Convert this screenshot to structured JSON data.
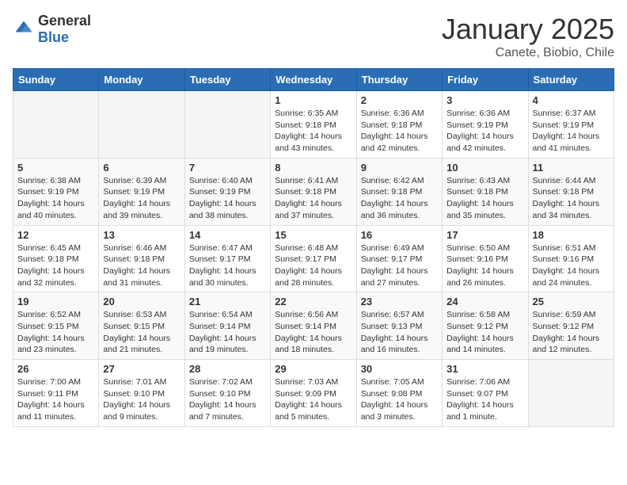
{
  "header": {
    "logo": {
      "general": "General",
      "blue": "Blue"
    },
    "title": "January 2025",
    "subtitle": "Canete, Biobio, Chile"
  },
  "weekdays": [
    "Sunday",
    "Monday",
    "Tuesday",
    "Wednesday",
    "Thursday",
    "Friday",
    "Saturday"
  ],
  "weeks": [
    [
      {
        "day": "",
        "sunrise": "",
        "sunset": "",
        "daylight": "",
        "empty": true
      },
      {
        "day": "",
        "sunrise": "",
        "sunset": "",
        "daylight": "",
        "empty": true
      },
      {
        "day": "",
        "sunrise": "",
        "sunset": "",
        "daylight": "",
        "empty": true
      },
      {
        "day": "1",
        "sunrise": "Sunrise: 6:35 AM",
        "sunset": "Sunset: 9:18 PM",
        "daylight": "Daylight: 14 hours and 43 minutes."
      },
      {
        "day": "2",
        "sunrise": "Sunrise: 6:36 AM",
        "sunset": "Sunset: 9:18 PM",
        "daylight": "Daylight: 14 hours and 42 minutes."
      },
      {
        "day": "3",
        "sunrise": "Sunrise: 6:36 AM",
        "sunset": "Sunset: 9:19 PM",
        "daylight": "Daylight: 14 hours and 42 minutes."
      },
      {
        "day": "4",
        "sunrise": "Sunrise: 6:37 AM",
        "sunset": "Sunset: 9:19 PM",
        "daylight": "Daylight: 14 hours and 41 minutes."
      }
    ],
    [
      {
        "day": "5",
        "sunrise": "Sunrise: 6:38 AM",
        "sunset": "Sunset: 9:19 PM",
        "daylight": "Daylight: 14 hours and 40 minutes."
      },
      {
        "day": "6",
        "sunrise": "Sunrise: 6:39 AM",
        "sunset": "Sunset: 9:19 PM",
        "daylight": "Daylight: 14 hours and 39 minutes."
      },
      {
        "day": "7",
        "sunrise": "Sunrise: 6:40 AM",
        "sunset": "Sunset: 9:19 PM",
        "daylight": "Daylight: 14 hours and 38 minutes."
      },
      {
        "day": "8",
        "sunrise": "Sunrise: 6:41 AM",
        "sunset": "Sunset: 9:18 PM",
        "daylight": "Daylight: 14 hours and 37 minutes."
      },
      {
        "day": "9",
        "sunrise": "Sunrise: 6:42 AM",
        "sunset": "Sunset: 9:18 PM",
        "daylight": "Daylight: 14 hours and 36 minutes."
      },
      {
        "day": "10",
        "sunrise": "Sunrise: 6:43 AM",
        "sunset": "Sunset: 9:18 PM",
        "daylight": "Daylight: 14 hours and 35 minutes."
      },
      {
        "day": "11",
        "sunrise": "Sunrise: 6:44 AM",
        "sunset": "Sunset: 9:18 PM",
        "daylight": "Daylight: 14 hours and 34 minutes."
      }
    ],
    [
      {
        "day": "12",
        "sunrise": "Sunrise: 6:45 AM",
        "sunset": "Sunset: 9:18 PM",
        "daylight": "Daylight: 14 hours and 32 minutes."
      },
      {
        "day": "13",
        "sunrise": "Sunrise: 6:46 AM",
        "sunset": "Sunset: 9:18 PM",
        "daylight": "Daylight: 14 hours and 31 minutes."
      },
      {
        "day": "14",
        "sunrise": "Sunrise: 6:47 AM",
        "sunset": "Sunset: 9:17 PM",
        "daylight": "Daylight: 14 hours and 30 minutes."
      },
      {
        "day": "15",
        "sunrise": "Sunrise: 6:48 AM",
        "sunset": "Sunset: 9:17 PM",
        "daylight": "Daylight: 14 hours and 28 minutes."
      },
      {
        "day": "16",
        "sunrise": "Sunrise: 6:49 AM",
        "sunset": "Sunset: 9:17 PM",
        "daylight": "Daylight: 14 hours and 27 minutes."
      },
      {
        "day": "17",
        "sunrise": "Sunrise: 6:50 AM",
        "sunset": "Sunset: 9:16 PM",
        "daylight": "Daylight: 14 hours and 26 minutes."
      },
      {
        "day": "18",
        "sunrise": "Sunrise: 6:51 AM",
        "sunset": "Sunset: 9:16 PM",
        "daylight": "Daylight: 14 hours and 24 minutes."
      }
    ],
    [
      {
        "day": "19",
        "sunrise": "Sunrise: 6:52 AM",
        "sunset": "Sunset: 9:15 PM",
        "daylight": "Daylight: 14 hours and 23 minutes."
      },
      {
        "day": "20",
        "sunrise": "Sunrise: 6:53 AM",
        "sunset": "Sunset: 9:15 PM",
        "daylight": "Daylight: 14 hours and 21 minutes."
      },
      {
        "day": "21",
        "sunrise": "Sunrise: 6:54 AM",
        "sunset": "Sunset: 9:14 PM",
        "daylight": "Daylight: 14 hours and 19 minutes."
      },
      {
        "day": "22",
        "sunrise": "Sunrise: 6:56 AM",
        "sunset": "Sunset: 9:14 PM",
        "daylight": "Daylight: 14 hours and 18 minutes."
      },
      {
        "day": "23",
        "sunrise": "Sunrise: 6:57 AM",
        "sunset": "Sunset: 9:13 PM",
        "daylight": "Daylight: 14 hours and 16 minutes."
      },
      {
        "day": "24",
        "sunrise": "Sunrise: 6:58 AM",
        "sunset": "Sunset: 9:12 PM",
        "daylight": "Daylight: 14 hours and 14 minutes."
      },
      {
        "day": "25",
        "sunrise": "Sunrise: 6:59 AM",
        "sunset": "Sunset: 9:12 PM",
        "daylight": "Daylight: 14 hours and 12 minutes."
      }
    ],
    [
      {
        "day": "26",
        "sunrise": "Sunrise: 7:00 AM",
        "sunset": "Sunset: 9:11 PM",
        "daylight": "Daylight: 14 hours and 11 minutes."
      },
      {
        "day": "27",
        "sunrise": "Sunrise: 7:01 AM",
        "sunset": "Sunset: 9:10 PM",
        "daylight": "Daylight: 14 hours and 9 minutes."
      },
      {
        "day": "28",
        "sunrise": "Sunrise: 7:02 AM",
        "sunset": "Sunset: 9:10 PM",
        "daylight": "Daylight: 14 hours and 7 minutes."
      },
      {
        "day": "29",
        "sunrise": "Sunrise: 7:03 AM",
        "sunset": "Sunset: 9:09 PM",
        "daylight": "Daylight: 14 hours and 5 minutes."
      },
      {
        "day": "30",
        "sunrise": "Sunrise: 7:05 AM",
        "sunset": "Sunset: 9:08 PM",
        "daylight": "Daylight: 14 hours and 3 minutes."
      },
      {
        "day": "31",
        "sunrise": "Sunrise: 7:06 AM",
        "sunset": "Sunset: 9:07 PM",
        "daylight": "Daylight: 14 hours and 1 minute."
      },
      {
        "day": "",
        "sunrise": "",
        "sunset": "",
        "daylight": "",
        "empty": true
      }
    ]
  ]
}
